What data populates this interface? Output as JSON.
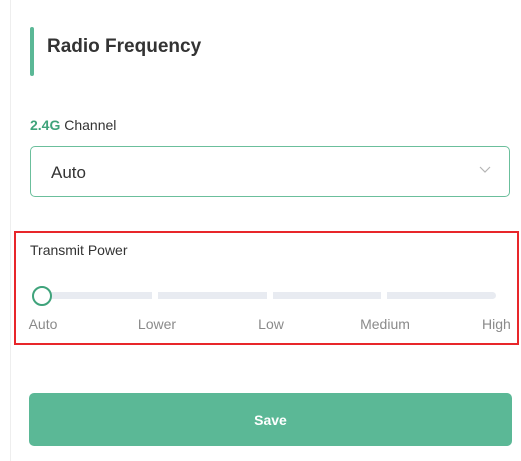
{
  "section": {
    "title": "Radio Frequency"
  },
  "channel": {
    "band": "2.4G",
    "label": "Channel",
    "selected": "Auto"
  },
  "transmit_power": {
    "label": "Transmit Power",
    "marks": [
      "Auto",
      "Lower",
      "Low",
      "Medium",
      "High"
    ],
    "selected_index": 0,
    "value_fraction": 0
  },
  "save_label": "Save",
  "colors": {
    "accent": "#5bb896",
    "accent_dark": "#3fa37b",
    "highlight_border": "#e8262a",
    "track": "#e8ebf1"
  },
  "icons": {
    "select_arrow": "chevron-down-icon"
  }
}
